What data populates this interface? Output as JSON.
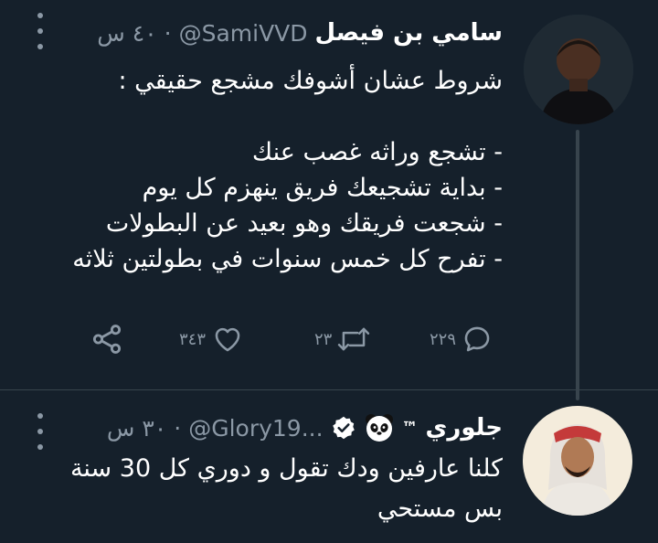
{
  "tweet1": {
    "display_name": "سامي بن فيصل",
    "handle": "@SamiVVD",
    "separator": "·",
    "time": "٤٠ س",
    "lines": [
      "شروط عشان أشوفك مشجع حقيقي :",
      "",
      "- تشجع وراثه غصب عنك",
      "- بداية تشجيعك فريق ينهزم كل يوم",
      "- شجعت فريقك وهو بعيد عن البطولات",
      "- تفرح كل خمس سنوات في بطولتين ثلاثه"
    ],
    "reply_count": "٢٢٩",
    "retweet_count": "٢٣",
    "like_count": "٣٤٣"
  },
  "tweet2": {
    "display_name": "جلوري",
    "name_suffix": "™",
    "handle": "@Glory19...",
    "separator": "·",
    "time": "٣٠ س",
    "lines": [
      "كلنا عارفين ودك تقول و دوري كل 30 سنة",
      "بس مستحي"
    ]
  },
  "colors": {
    "background": "#15202b",
    "text_primary": "#ffffff",
    "text_secondary": "#8b98a5",
    "divider": "#38444d",
    "verified": "#ffffff"
  },
  "icons": [
    "reply-icon",
    "retweet-icon",
    "like-icon",
    "share-icon",
    "more-icon",
    "verified-icon",
    "panda-emoji"
  ]
}
